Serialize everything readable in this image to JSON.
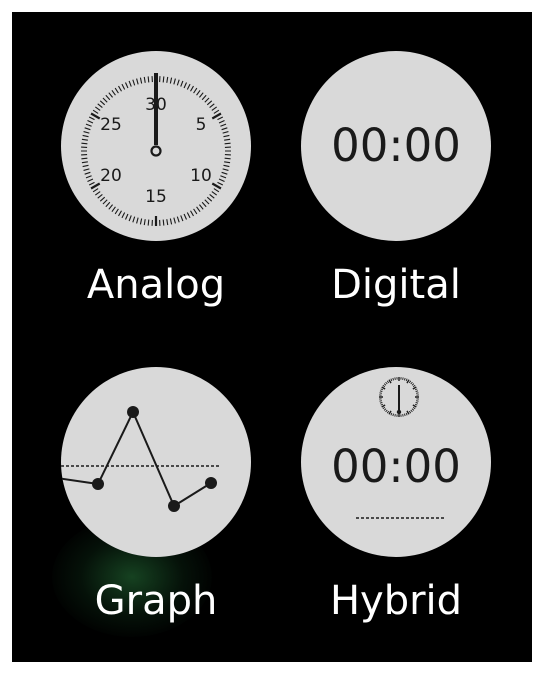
{
  "options": [
    {
      "id": "analog",
      "label": "Analog",
      "dial_numbers": [
        "30",
        "5",
        "10",
        "15",
        "20",
        "25"
      ]
    },
    {
      "id": "digital",
      "label": "Digital",
      "time": "00:00"
    },
    {
      "id": "graph",
      "label": "Graph"
    },
    {
      "id": "hybrid",
      "label": "Hybrid",
      "time": "00:00"
    }
  ],
  "colors": {
    "background": "#000000",
    "face": "#d9d9d9",
    "ink": "#1a1a1a",
    "label": "#ffffff"
  }
}
